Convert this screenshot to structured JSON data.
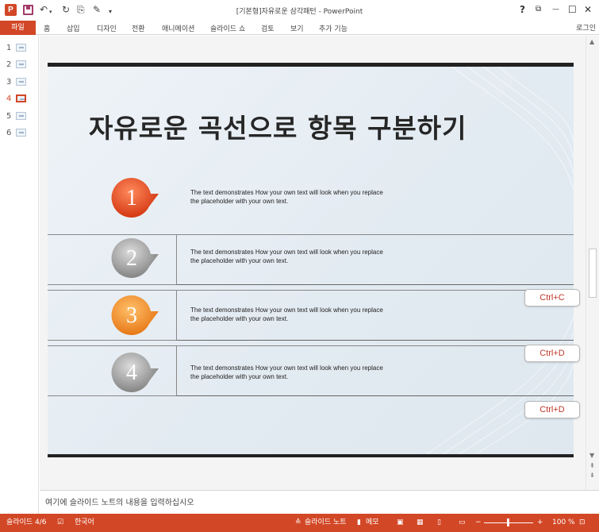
{
  "app": {
    "window_title": "[기본형]자유로운 삼각패턴 - PowerPoint",
    "login": "로그인"
  },
  "ribbon": {
    "tabs": [
      "파일",
      "홈",
      "삽입",
      "디자인",
      "전환",
      "애니메이션",
      "슬라이드 쇼",
      "검토",
      "보기",
      "추가 기능"
    ]
  },
  "window_controls": [
    "?",
    "⧉",
    "—",
    "☐",
    "✕"
  ],
  "thumbnails": [
    {
      "num": "1"
    },
    {
      "num": "2"
    },
    {
      "num": "3"
    },
    {
      "num": "4"
    },
    {
      "num": "5"
    },
    {
      "num": "6"
    }
  ],
  "slide": {
    "title": "자유로운 곡선으로 항목 구분하기",
    "items": [
      {
        "number": "1",
        "line1": "The text demonstrates How your own text will look when you replace",
        "line2": "the placeholder with your own text.",
        "color": "#e8431d"
      },
      {
        "number": "2",
        "line1": "The text demonstrates How your own text will look when you replace",
        "line2": "the placeholder with your own text.",
        "color": "#9a9a9a"
      },
      {
        "number": "3",
        "line1": "The text demonstrates How your own text will look when you replace",
        "line2": "the placeholder with your own text.",
        "color": "#ef8a1e"
      },
      {
        "number": "4",
        "line1": "The text demonstrates How your own text will look when you replace",
        "line2": "the placeholder with your own text.",
        "color": "#9a9a9a"
      }
    ]
  },
  "shortcuts": [
    "Ctrl+C",
    "Ctrl+D",
    "Ctrl+D"
  ],
  "notes": {
    "placeholder": "여기에 슬라이드 노트의 내용을 입력하십시오"
  },
  "status": {
    "slide_counter": "슬라이드 4/6",
    "language": "한국어",
    "notes_btn": "슬라이드 노트",
    "comments_btn": "메모",
    "zoom": "100 %",
    "zoom_minus": "−",
    "zoom_plus": "+"
  },
  "colors": {
    "accent": "#d24726",
    "ctrl_text": "#c0392b"
  }
}
